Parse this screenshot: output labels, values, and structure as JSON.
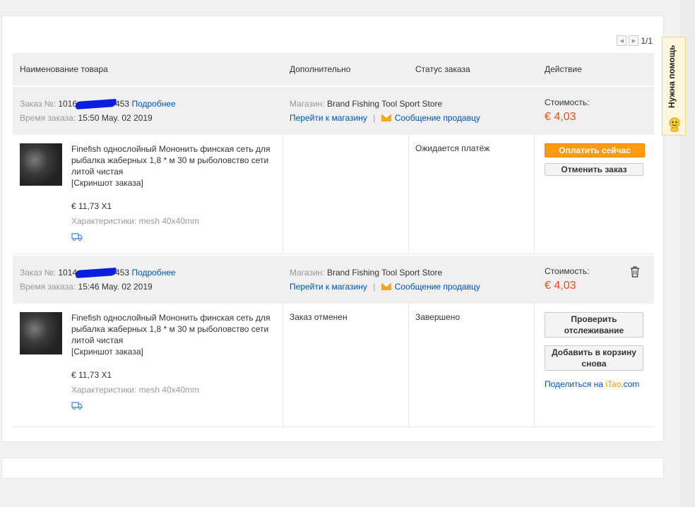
{
  "pager": {
    "text": "1/1"
  },
  "table_headers": {
    "product": "Наименование товара",
    "additional": "Дополнительно",
    "status": "Статус заказа",
    "action": "Действие"
  },
  "help": {
    "label": "Нужна помощь"
  },
  "orders": [
    {
      "order_label": "Заказ №:",
      "order_no_start": "1016",
      "order_no_end": "453",
      "details_link": "Подробнее",
      "time_label": "Время заказа:",
      "time": "15:50 May. 02 2019",
      "store_label": "Магазин:",
      "store_name": "Brand Fishing Tool Sport Store",
      "store_link": "Перейти к магазину",
      "separator": "|",
      "message_link": "Сообщение продавцу",
      "cost_label": "Стоимость:",
      "cost": "€ 4,03",
      "product_title": "Finefish однослойный Мононить финская сеть для рыбалка жаберных 1,8 * м 30 м рыболовство сети литой чистая",
      "snapshot": "[Скриншот заказа]",
      "price": "€ 11,73 X1",
      "specs": "Характеристики: mesh 40x40mm",
      "additional": "",
      "status": "Ожидается платёж",
      "pay_button": "Оплатить сейчас",
      "cancel_button": "Отменить заказ"
    },
    {
      "order_label": "Заказ №:",
      "order_no_start": "1014",
      "order_no_end": "453",
      "details_link": "Подробнее",
      "time_label": "Время заказа:",
      "time": "15:46 May. 02 2019",
      "store_label": "Магазин:",
      "store_name": "Brand Fishing Tool Sport Store",
      "store_link": "Перейти к магазину",
      "separator": "|",
      "message_link": "Сообщение продавцу",
      "cost_label": "Стоимость:",
      "cost": "€ 4,03",
      "product_title": "Finefish однослойный Мононить финская сеть для рыбалка жаберных 1,8 * м 30 м рыболовство сети литой чистая",
      "snapshot": "[Скриншот заказа]",
      "price": "€ 11,73 X1",
      "specs": "Характеристики: mesh 40x40mm",
      "additional": "Заказ отменен",
      "status": "Завершено",
      "track_button_line1": "Проверить",
      "track_button_line2": "отслеживание",
      "cart_button_line1": "Добавить в корзину",
      "cart_button_line2": "снова",
      "share_text": "Поделиться на",
      "share_brand_i": "i",
      "share_brand_tao": "Tao",
      "share_brand_com": ".com"
    }
  ],
  "colors": {
    "accent_orange": "#ff9b13",
    "price_red": "#e94b1c",
    "link_blue": "#0052b4"
  }
}
